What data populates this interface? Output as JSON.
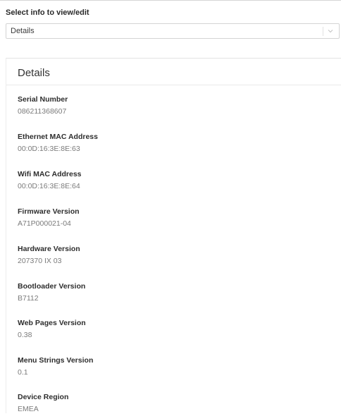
{
  "selector": {
    "label": "Select info to view/edit",
    "selected": "Details"
  },
  "panel": {
    "title": "Details",
    "fields": [
      {
        "label": "Serial Number",
        "value": "086211368607"
      },
      {
        "label": "Ethernet MAC Address",
        "value": "00:0D:16:3E:8E:63"
      },
      {
        "label": "Wifi MAC Address",
        "value": "00:0D:16:3E:8E:64"
      },
      {
        "label": "Firmware Version",
        "value": "A71P000021-04"
      },
      {
        "label": "Hardware Version",
        "value": "207370 IX 03"
      },
      {
        "label": "Bootloader Version",
        "value": "B7112"
      },
      {
        "label": "Web Pages Version",
        "value": "0.38"
      },
      {
        "label": "Menu Strings Version",
        "value": "0.1"
      },
      {
        "label": "Device Region",
        "value": "EMEA"
      }
    ]
  },
  "icons": {
    "dropdown": "chevron-down-icon"
  }
}
